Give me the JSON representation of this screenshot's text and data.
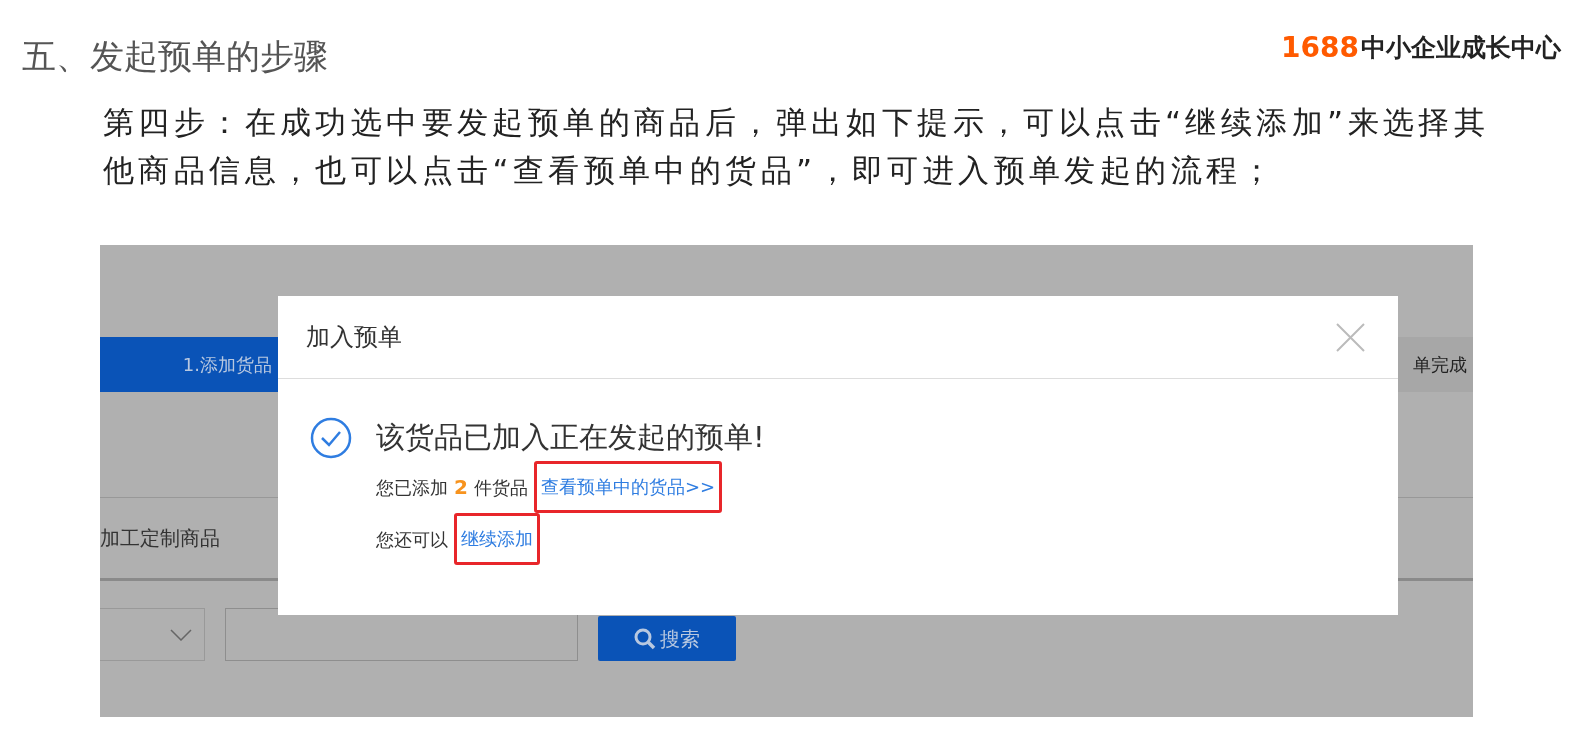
{
  "slide": {
    "title": "五、发起预单的步骤",
    "brand": {
      "number": "1688",
      "name": "中小企业成长中心"
    },
    "paragraph": "第四步：在成功选中要发起预单的商品后，弹出如下提示，可以点击“继续添加”来选择其他商品信息，也可以点击“查看预单中的货品”，即可进入预单发起的流程；"
  },
  "screenshot": {
    "steps": [
      {
        "label": "1.添加货品",
        "selected": true
      },
      {
        "label": "单完成",
        "selected": false
      }
    ],
    "category": "加工定制商品",
    "search_button": "搜索",
    "dialog": {
      "title": "加入预单",
      "message": "该货品已加入正在发起的预单!",
      "count_prefix": "您已添加",
      "count": "2",
      "count_suffix": "件货品",
      "view_link": {
        "label": "查看预单中的货品>>",
        "highlighted": true
      },
      "more_prefix": "您还可以",
      "continue_link": {
        "label": "继续添加",
        "highlighted": true
      }
    }
  }
}
